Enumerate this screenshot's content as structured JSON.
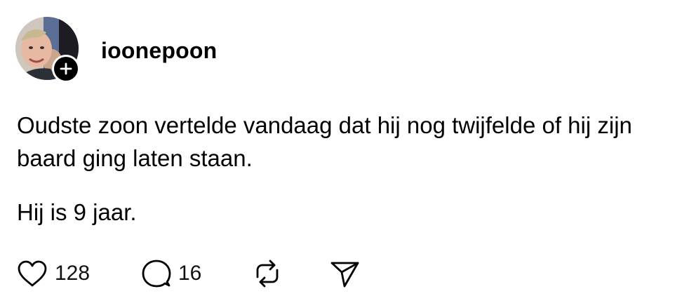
{
  "post": {
    "username": "ioonepoon",
    "paragraphs": [
      "Oudste zoon vertelde vandaag dat hij nog twijfelde of hij zijn baard ging laten staan.",
      "Hij is 9 jaar."
    ],
    "actions": {
      "like_count": "128",
      "reply_count": "16"
    }
  },
  "icons": {
    "like": "heart-icon",
    "reply": "speech-bubble-icon",
    "repost": "repost-arrows-icon",
    "share": "paper-plane-icon",
    "follow": "plus-icon"
  },
  "colors": {
    "text": "#000000",
    "background": "#ffffff",
    "badge": "#000000"
  }
}
